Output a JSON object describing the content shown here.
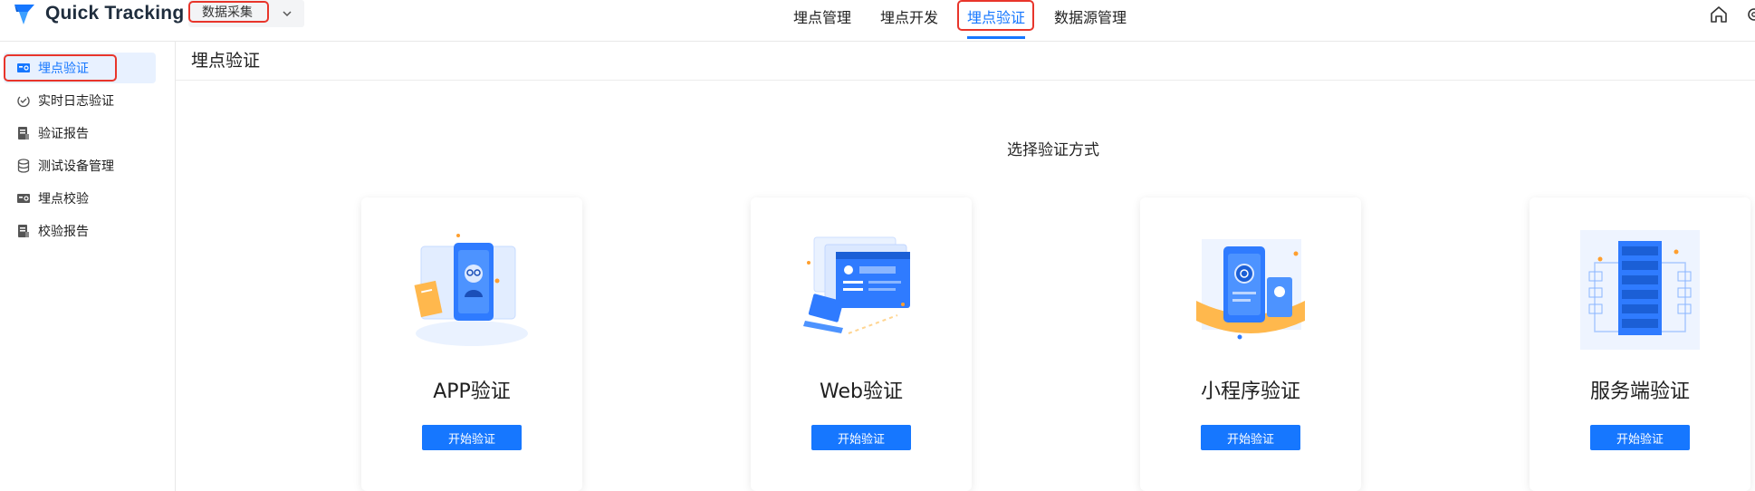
{
  "app": {
    "name": "Quick Tracking"
  },
  "product_select": {
    "value": "数据采集"
  },
  "nav": {
    "items": [
      {
        "label": "埋点管理"
      },
      {
        "label": "埋点开发"
      },
      {
        "label": "埋点验证",
        "active": true
      },
      {
        "label": "数据源管理"
      }
    ]
  },
  "sidebar": {
    "items": [
      {
        "label": "埋点验证",
        "icon": "verify-icon",
        "active": true
      },
      {
        "label": "实时日志验证",
        "icon": "realtime-log-icon"
      },
      {
        "label": "验证报告",
        "icon": "report-icon"
      },
      {
        "label": "测试设备管理",
        "icon": "database-icon"
      },
      {
        "label": "埋点校验",
        "icon": "check-icon"
      },
      {
        "label": "校验报告",
        "icon": "report-icon"
      }
    ]
  },
  "main": {
    "title": "埋点验证",
    "section_title": "选择验证方式",
    "cards": [
      {
        "title": "APP验证",
        "button": "开始验证",
        "illustration": "mobile-app-icon"
      },
      {
        "title": "Web验证",
        "button": "开始验证",
        "illustration": "web-browser-icon"
      },
      {
        "title": "小程序验证",
        "button": "开始验证",
        "illustration": "mini-program-icon"
      },
      {
        "title": "服务端验证",
        "button": "开始验证",
        "illustration": "server-icon"
      }
    ]
  },
  "colors": {
    "accent": "#1677ff",
    "highlight_box": "#e8352b",
    "active_bg": "#e8f1ff"
  }
}
